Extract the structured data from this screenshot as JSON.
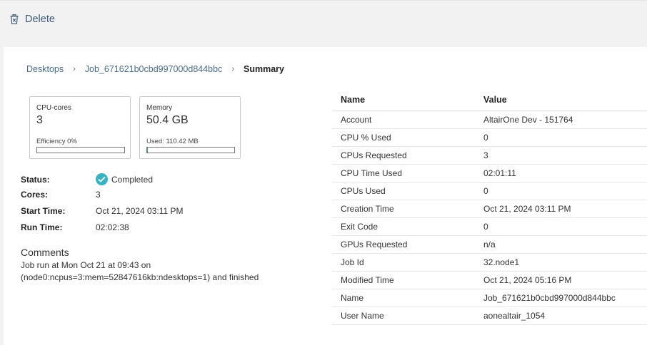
{
  "toolbar": {
    "delete_label": "Delete",
    "delete_icon": "trash-icon"
  },
  "breadcrumb": {
    "items": [
      "Desktops",
      "Job_671621b0cbd997000d844bbc"
    ],
    "current": "Summary",
    "separator": "›"
  },
  "cards": [
    {
      "label": "CPU-cores",
      "value": "3",
      "sub": "Efficiency 0%",
      "fill_fraction": 0.0
    },
    {
      "label": "Memory",
      "value": "50.4 GB",
      "sub": "Used: 110.42 MB",
      "fill_fraction": 0.01
    }
  ],
  "status": {
    "status_label": "Status:",
    "status_value": "Completed",
    "cores_label": "Cores:",
    "cores_value": "3",
    "start_label": "Start Time:",
    "start_value": "Oct 21, 2024 03:11 PM",
    "run_label": "Run Time:",
    "run_value": "02:02:38"
  },
  "comments": {
    "title": "Comments",
    "line1": "Job run at Mon Oct 21 at 09:43 on",
    "line2": "(node0:ncpus=3:mem=52847616kb:ndesktops=1) and finished"
  },
  "table": {
    "headers": [
      "Name",
      "Value"
    ],
    "rows": [
      [
        "Account",
        "AltairOne  Dev - 151764"
      ],
      [
        "CPU % Used",
        "0"
      ],
      [
        "CPUs Requested",
        "3"
      ],
      [
        "CPU Time Used",
        "02:01:11"
      ],
      [
        "CPUs Used",
        "0"
      ],
      [
        "Creation Time",
        "Oct 21, 2024 03:11 PM"
      ],
      [
        "Exit Code",
        "0"
      ],
      [
        "GPUs Requested",
        "n/a"
      ],
      [
        "Job Id",
        "32.node1"
      ],
      [
        "Modified Time",
        "Oct 21, 2024 05:16 PM"
      ],
      [
        "Name",
        "Job_671621b0cbd997000d844bbc"
      ],
      [
        "User Name",
        "aonealtair_1054"
      ]
    ]
  },
  "colors": {
    "accent": "#3b5a7a",
    "status_ok": "#36b3c2",
    "bar_fill": "#3aa655"
  }
}
